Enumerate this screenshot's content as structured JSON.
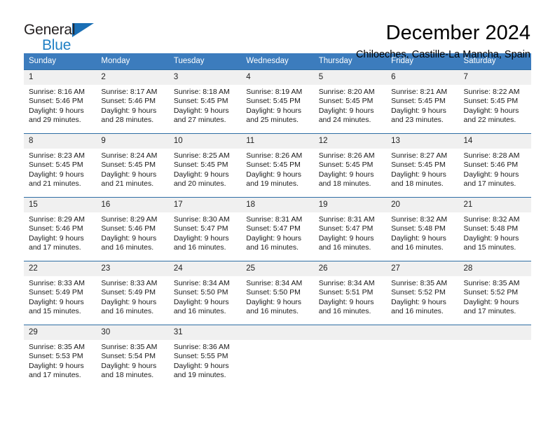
{
  "brand": {
    "name_part1": "General",
    "name_part2": "Blue",
    "triangle_color": "#1a6fb5",
    "blue_text_color": "#1f7fc4"
  },
  "header": {
    "title": "December 2024",
    "subtitle": "Chiloeches, Castille-La Mancha, Spain"
  },
  "colors": {
    "header_row_bg": "#3c7cbd",
    "row_border": "#2e6da4",
    "day_number_bg": "#f0f0f0"
  },
  "weekday_headers": [
    "Sunday",
    "Monday",
    "Tuesday",
    "Wednesday",
    "Thursday",
    "Friday",
    "Saturday"
  ],
  "weeks": [
    {
      "days": [
        {
          "num": "1",
          "sunrise": "Sunrise: 8:16 AM",
          "sunset": "Sunset: 5:46 PM",
          "daylight_line1": "Daylight: 9 hours",
          "daylight_line2": "and 29 minutes."
        },
        {
          "num": "2",
          "sunrise": "Sunrise: 8:17 AM",
          "sunset": "Sunset: 5:46 PM",
          "daylight_line1": "Daylight: 9 hours",
          "daylight_line2": "and 28 minutes."
        },
        {
          "num": "3",
          "sunrise": "Sunrise: 8:18 AM",
          "sunset": "Sunset: 5:45 PM",
          "daylight_line1": "Daylight: 9 hours",
          "daylight_line2": "and 27 minutes."
        },
        {
          "num": "4",
          "sunrise": "Sunrise: 8:19 AM",
          "sunset": "Sunset: 5:45 PM",
          "daylight_line1": "Daylight: 9 hours",
          "daylight_line2": "and 25 minutes."
        },
        {
          "num": "5",
          "sunrise": "Sunrise: 8:20 AM",
          "sunset": "Sunset: 5:45 PM",
          "daylight_line1": "Daylight: 9 hours",
          "daylight_line2": "and 24 minutes."
        },
        {
          "num": "6",
          "sunrise": "Sunrise: 8:21 AM",
          "sunset": "Sunset: 5:45 PM",
          "daylight_line1": "Daylight: 9 hours",
          "daylight_line2": "and 23 minutes."
        },
        {
          "num": "7",
          "sunrise": "Sunrise: 8:22 AM",
          "sunset": "Sunset: 5:45 PM",
          "daylight_line1": "Daylight: 9 hours",
          "daylight_line2": "and 22 minutes."
        }
      ]
    },
    {
      "days": [
        {
          "num": "8",
          "sunrise": "Sunrise: 8:23 AM",
          "sunset": "Sunset: 5:45 PM",
          "daylight_line1": "Daylight: 9 hours",
          "daylight_line2": "and 21 minutes."
        },
        {
          "num": "9",
          "sunrise": "Sunrise: 8:24 AM",
          "sunset": "Sunset: 5:45 PM",
          "daylight_line1": "Daylight: 9 hours",
          "daylight_line2": "and 21 minutes."
        },
        {
          "num": "10",
          "sunrise": "Sunrise: 8:25 AM",
          "sunset": "Sunset: 5:45 PM",
          "daylight_line1": "Daylight: 9 hours",
          "daylight_line2": "and 20 minutes."
        },
        {
          "num": "11",
          "sunrise": "Sunrise: 8:26 AM",
          "sunset": "Sunset: 5:45 PM",
          "daylight_line1": "Daylight: 9 hours",
          "daylight_line2": "and 19 minutes."
        },
        {
          "num": "12",
          "sunrise": "Sunrise: 8:26 AM",
          "sunset": "Sunset: 5:45 PM",
          "daylight_line1": "Daylight: 9 hours",
          "daylight_line2": "and 18 minutes."
        },
        {
          "num": "13",
          "sunrise": "Sunrise: 8:27 AM",
          "sunset": "Sunset: 5:45 PM",
          "daylight_line1": "Daylight: 9 hours",
          "daylight_line2": "and 18 minutes."
        },
        {
          "num": "14",
          "sunrise": "Sunrise: 8:28 AM",
          "sunset": "Sunset: 5:46 PM",
          "daylight_line1": "Daylight: 9 hours",
          "daylight_line2": "and 17 minutes."
        }
      ]
    },
    {
      "days": [
        {
          "num": "15",
          "sunrise": "Sunrise: 8:29 AM",
          "sunset": "Sunset: 5:46 PM",
          "daylight_line1": "Daylight: 9 hours",
          "daylight_line2": "and 17 minutes."
        },
        {
          "num": "16",
          "sunrise": "Sunrise: 8:29 AM",
          "sunset": "Sunset: 5:46 PM",
          "daylight_line1": "Daylight: 9 hours",
          "daylight_line2": "and 16 minutes."
        },
        {
          "num": "17",
          "sunrise": "Sunrise: 8:30 AM",
          "sunset": "Sunset: 5:47 PM",
          "daylight_line1": "Daylight: 9 hours",
          "daylight_line2": "and 16 minutes."
        },
        {
          "num": "18",
          "sunrise": "Sunrise: 8:31 AM",
          "sunset": "Sunset: 5:47 PM",
          "daylight_line1": "Daylight: 9 hours",
          "daylight_line2": "and 16 minutes."
        },
        {
          "num": "19",
          "sunrise": "Sunrise: 8:31 AM",
          "sunset": "Sunset: 5:47 PM",
          "daylight_line1": "Daylight: 9 hours",
          "daylight_line2": "and 16 minutes."
        },
        {
          "num": "20",
          "sunrise": "Sunrise: 8:32 AM",
          "sunset": "Sunset: 5:48 PM",
          "daylight_line1": "Daylight: 9 hours",
          "daylight_line2": "and 16 minutes."
        },
        {
          "num": "21",
          "sunrise": "Sunrise: 8:32 AM",
          "sunset": "Sunset: 5:48 PM",
          "daylight_line1": "Daylight: 9 hours",
          "daylight_line2": "and 15 minutes."
        }
      ]
    },
    {
      "days": [
        {
          "num": "22",
          "sunrise": "Sunrise: 8:33 AM",
          "sunset": "Sunset: 5:49 PM",
          "daylight_line1": "Daylight: 9 hours",
          "daylight_line2": "and 15 minutes."
        },
        {
          "num": "23",
          "sunrise": "Sunrise: 8:33 AM",
          "sunset": "Sunset: 5:49 PM",
          "daylight_line1": "Daylight: 9 hours",
          "daylight_line2": "and 16 minutes."
        },
        {
          "num": "24",
          "sunrise": "Sunrise: 8:34 AM",
          "sunset": "Sunset: 5:50 PM",
          "daylight_line1": "Daylight: 9 hours",
          "daylight_line2": "and 16 minutes."
        },
        {
          "num": "25",
          "sunrise": "Sunrise: 8:34 AM",
          "sunset": "Sunset: 5:50 PM",
          "daylight_line1": "Daylight: 9 hours",
          "daylight_line2": "and 16 minutes."
        },
        {
          "num": "26",
          "sunrise": "Sunrise: 8:34 AM",
          "sunset": "Sunset: 5:51 PM",
          "daylight_line1": "Daylight: 9 hours",
          "daylight_line2": "and 16 minutes."
        },
        {
          "num": "27",
          "sunrise": "Sunrise: 8:35 AM",
          "sunset": "Sunset: 5:52 PM",
          "daylight_line1": "Daylight: 9 hours",
          "daylight_line2": "and 16 minutes."
        },
        {
          "num": "28",
          "sunrise": "Sunrise: 8:35 AM",
          "sunset": "Sunset: 5:52 PM",
          "daylight_line1": "Daylight: 9 hours",
          "daylight_line2": "and 17 minutes."
        }
      ]
    },
    {
      "days": [
        {
          "num": "29",
          "sunrise": "Sunrise: 8:35 AM",
          "sunset": "Sunset: 5:53 PM",
          "daylight_line1": "Daylight: 9 hours",
          "daylight_line2": "and 17 minutes."
        },
        {
          "num": "30",
          "sunrise": "Sunrise: 8:35 AM",
          "sunset": "Sunset: 5:54 PM",
          "daylight_line1": "Daylight: 9 hours",
          "daylight_line2": "and 18 minutes."
        },
        {
          "num": "31",
          "sunrise": "Sunrise: 8:36 AM",
          "sunset": "Sunset: 5:55 PM",
          "daylight_line1": "Daylight: 9 hours",
          "daylight_line2": "and 19 minutes."
        },
        {
          "num": "",
          "sunrise": "",
          "sunset": "",
          "daylight_line1": "",
          "daylight_line2": ""
        },
        {
          "num": "",
          "sunrise": "",
          "sunset": "",
          "daylight_line1": "",
          "daylight_line2": ""
        },
        {
          "num": "",
          "sunrise": "",
          "sunset": "",
          "daylight_line1": "",
          "daylight_line2": ""
        },
        {
          "num": "",
          "sunrise": "",
          "sunset": "",
          "daylight_line1": "",
          "daylight_line2": ""
        }
      ]
    }
  ]
}
